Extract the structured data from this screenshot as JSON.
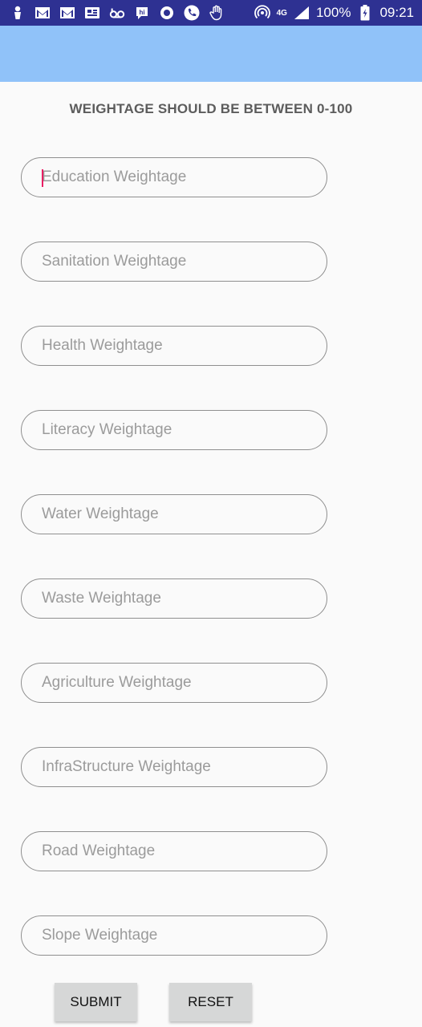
{
  "status_bar": {
    "battery": "100%",
    "time": "09:21",
    "network_badge": "4G",
    "icons": [
      "person-icon",
      "gmail-icon",
      "gmail-icon",
      "news-icon",
      "voicemail-icon",
      "hike-icon",
      "circle-app-icon",
      "phone-call-icon",
      "hand-icon",
      "hotspot-icon",
      "signal-icon",
      "battery-icon"
    ]
  },
  "header": {
    "instruction": "WEIGHTAGE SHOULD BE BETWEEN 0-100"
  },
  "form": {
    "fields": [
      {
        "placeholder": "Education Weightage",
        "value": ""
      },
      {
        "placeholder": "Sanitation Weightage",
        "value": ""
      },
      {
        "placeholder": "Health Weightage",
        "value": ""
      },
      {
        "placeholder": "Literacy Weightage",
        "value": ""
      },
      {
        "placeholder": "Water Weightage",
        "value": ""
      },
      {
        "placeholder": "Waste Weightage",
        "value": ""
      },
      {
        "placeholder": "Agriculture Weightage",
        "value": ""
      },
      {
        "placeholder": "InfraStructure Weightage",
        "value": ""
      },
      {
        "placeholder": "Road Weightage",
        "value": ""
      },
      {
        "placeholder": "Slope Weightage",
        "value": ""
      }
    ],
    "submit_label": "SUBMIT",
    "reset_label": "RESET"
  },
  "colors": {
    "status_bar": "#2e3192",
    "app_bar": "#90c2f9",
    "background": "#fafafa",
    "cursor": "#e91e63",
    "button": "#d6d7d7"
  }
}
